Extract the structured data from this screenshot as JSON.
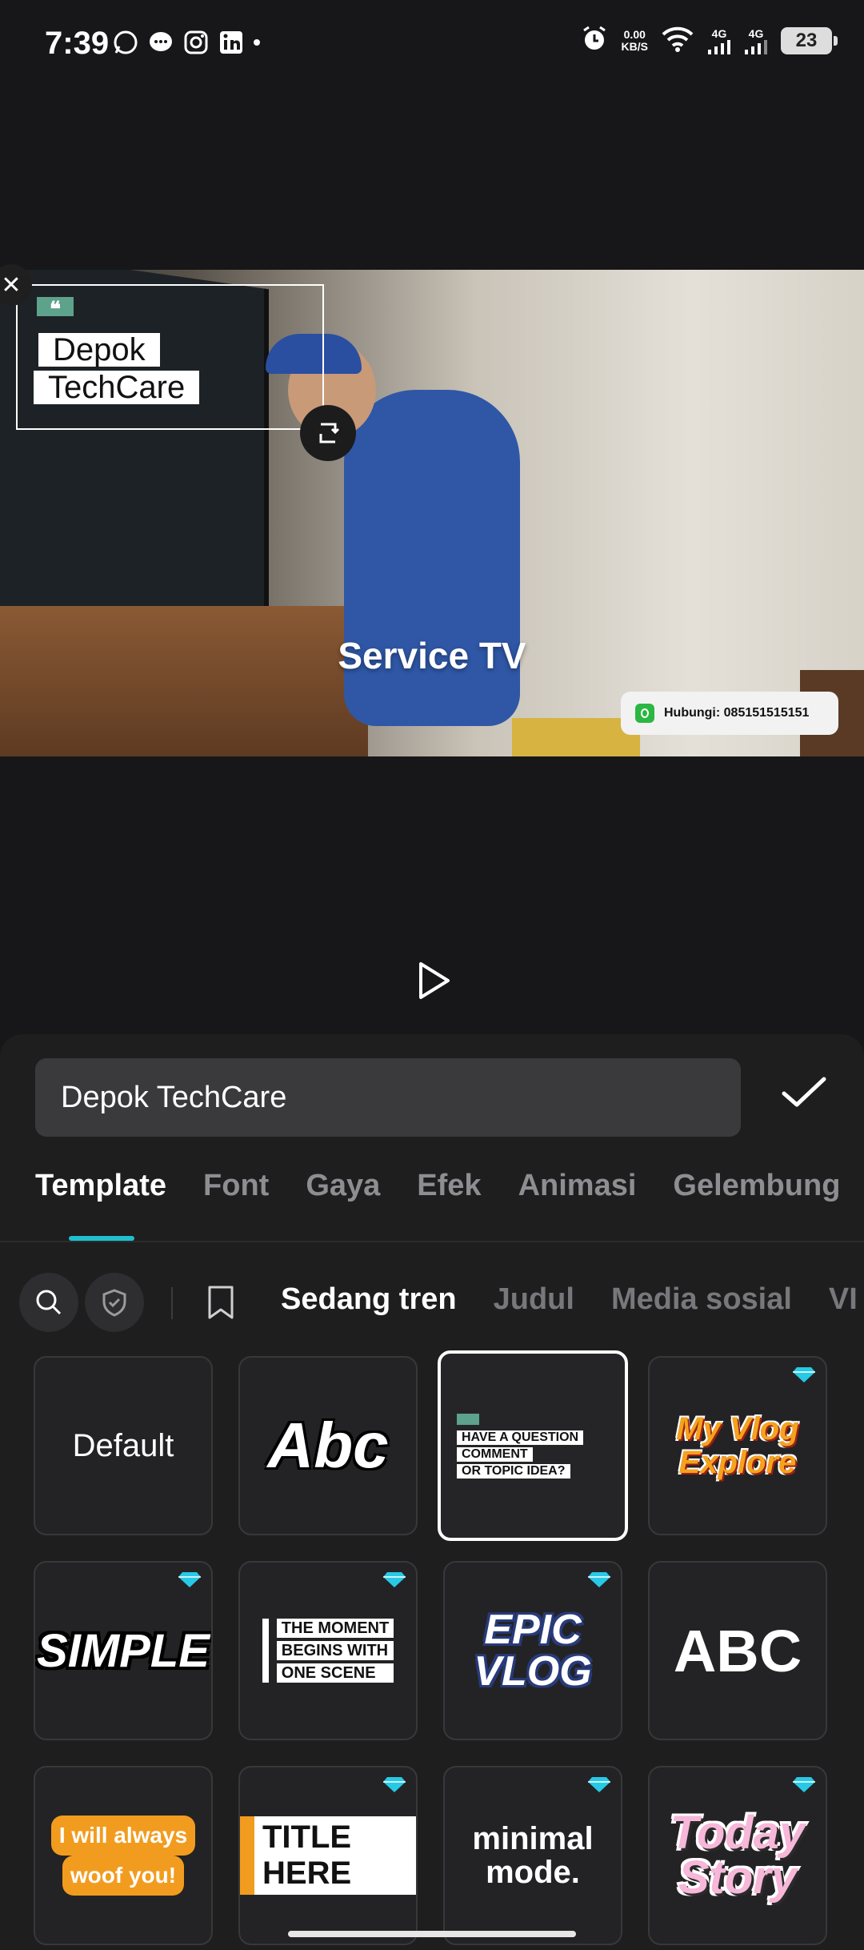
{
  "status_bar": {
    "time": "7:39",
    "net_speed_value": "0.00",
    "net_speed_unit": "KB/S",
    "signal1": "4G",
    "signal2": "4G",
    "battery": "23",
    "icons": [
      "whatsapp-icon",
      "messenger-icon",
      "instagram-icon",
      "linkedin-icon",
      "dot-icon",
      "alarm-icon",
      "wifi-icon"
    ]
  },
  "preview": {
    "overlay_line1": "Depok",
    "overlay_line2": "TechCare",
    "quote_glyph": "❝",
    "video_title": "Service TV",
    "contact_text": "Hubungi: 085151515151"
  },
  "editor": {
    "text_value": "Depok TechCare",
    "tabs": [
      "Template",
      "Font",
      "Gaya",
      "Efek",
      "Animasi",
      "Gelembung"
    ],
    "active_tab": "Template",
    "categories": [
      "Sedang tren",
      "Judul",
      "Media sosial",
      "VI"
    ],
    "active_category": "Sedang tren"
  },
  "templates": {
    "default": "Default",
    "abc": "Abc",
    "question": [
      "HAVE A QUESTION",
      "COMMENT",
      "OR TOPIC IDEA?"
    ],
    "vlog": [
      "My Vlog",
      "Explore"
    ],
    "simple": "SIMPLE",
    "moment": [
      "THE MOMENT",
      "BEGINS WITH",
      "ONE SCENE"
    ],
    "epic": [
      "EPIC",
      "VLOG"
    ],
    "abc_caps": "ABC",
    "woof": [
      "I will always",
      "woof you!"
    ],
    "title_here": "TITLE HERE",
    "minimal": [
      "minimal",
      "mode."
    ],
    "today": [
      "Today",
      "Story"
    ]
  },
  "colors": {
    "accent": "#1fbfd0",
    "premium_gem": "#27c9e6",
    "quote_green": "#5da28a"
  }
}
